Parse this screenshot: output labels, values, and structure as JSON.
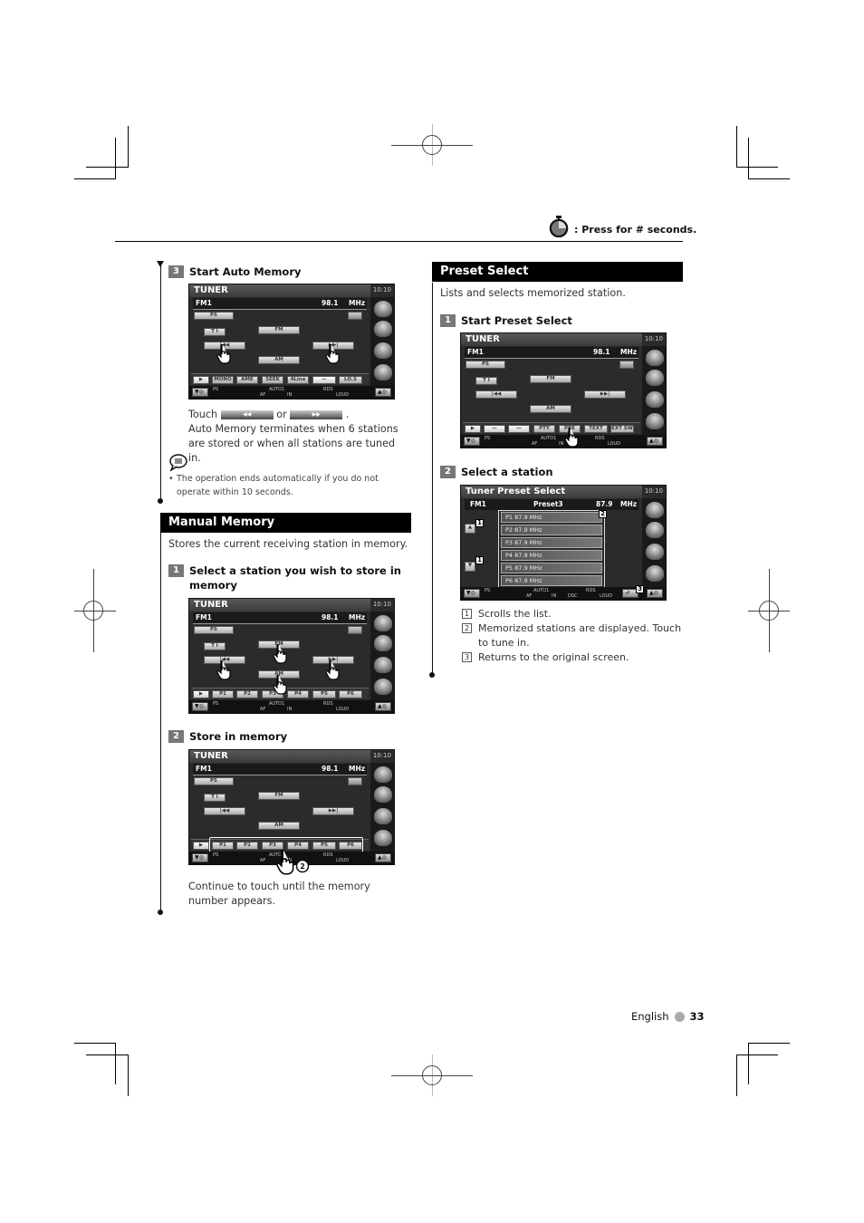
{
  "header": {
    "press_note": ": Press for # seconds.",
    "icon": "stopwatch-icon"
  },
  "left": {
    "step3": {
      "num": "3",
      "title": "Start Auto Memory"
    },
    "screen_auto": {
      "title": "TUNER",
      "clock": "10:10",
      "band": "FM1",
      "freq": "98.1",
      "unit": "MHz",
      "ps": "PS",
      "ti": "T I",
      "fm": "FM",
      "am": "AM",
      "prev": "|◀◀",
      "next": "▶▶|",
      "bottom_buttons": [
        "MONO",
        "AME",
        "SEEK",
        "4Line",
        "—",
        "LO.S"
      ],
      "status": {
        "ps": "PS",
        "auto": "AUTO1",
        "rds": "RDS",
        "af": "AF",
        "in": "IN",
        "loud": "LOUD"
      }
    },
    "touch_line": {
      "touch": "Touch",
      "or": "or",
      "end": ".",
      "btn_prev": "◀◀",
      "btn_next": "▶▶"
    },
    "auto_memory_desc": "Auto Memory terminates when 6 stations are stored or when all stations are tuned in.",
    "note": "The operation ends automatically if you do not operate within 10 seconds.",
    "manual_memory": {
      "title": "Manual Memory",
      "desc": "Stores the current receiving station in memory.",
      "step1": {
        "num": "1",
        "title": "Select a station you wish to store in memory"
      },
      "step2": {
        "num": "2",
        "title": "Store in memory"
      },
      "presets": [
        "P1",
        "P2",
        "P3",
        "P4",
        "P5",
        "P6"
      ],
      "continue_text": "Continue to touch until the memory number appears.",
      "hold_seconds": "2"
    }
  },
  "right": {
    "preset_select": {
      "title": "Preset Select",
      "desc": "Lists and selects memorized station.",
      "step1": {
        "num": "1",
        "title": "Start Preset Select"
      },
      "step2": {
        "num": "2",
        "title": "Select a station"
      },
      "bottom_buttons": [
        "—",
        "—",
        "PTY",
        "PRE",
        "TEXT",
        "EXT SW"
      ],
      "list_screen": {
        "title": "Tuner Preset Select",
        "clock": "10:10",
        "band": "FM1",
        "preset": "Preset3",
        "freq": "87.9",
        "unit": "MHz",
        "items": [
          "P1  87.9  MHz",
          "P2  87.9  MHz",
          "P3  87.9  MHz",
          "P4  87.9  MHz",
          "P5  87.9  MHz",
          "P6  87.9  MHz"
        ],
        "status": {
          "ps": "PS",
          "auto": "AUTO1",
          "rds": "RDS",
          "af": "AF",
          "in": "IN",
          "dsc": "DSC",
          "loud": "LOUD"
        }
      },
      "legend": [
        {
          "num": "1",
          "text": "Scrolls the list."
        },
        {
          "num": "2",
          "text": "Memorized stations are displayed. Touch to tune in."
        },
        {
          "num": "3",
          "text": "Returns to the original screen."
        }
      ]
    }
  },
  "footer": {
    "language": "English",
    "page": "33"
  }
}
